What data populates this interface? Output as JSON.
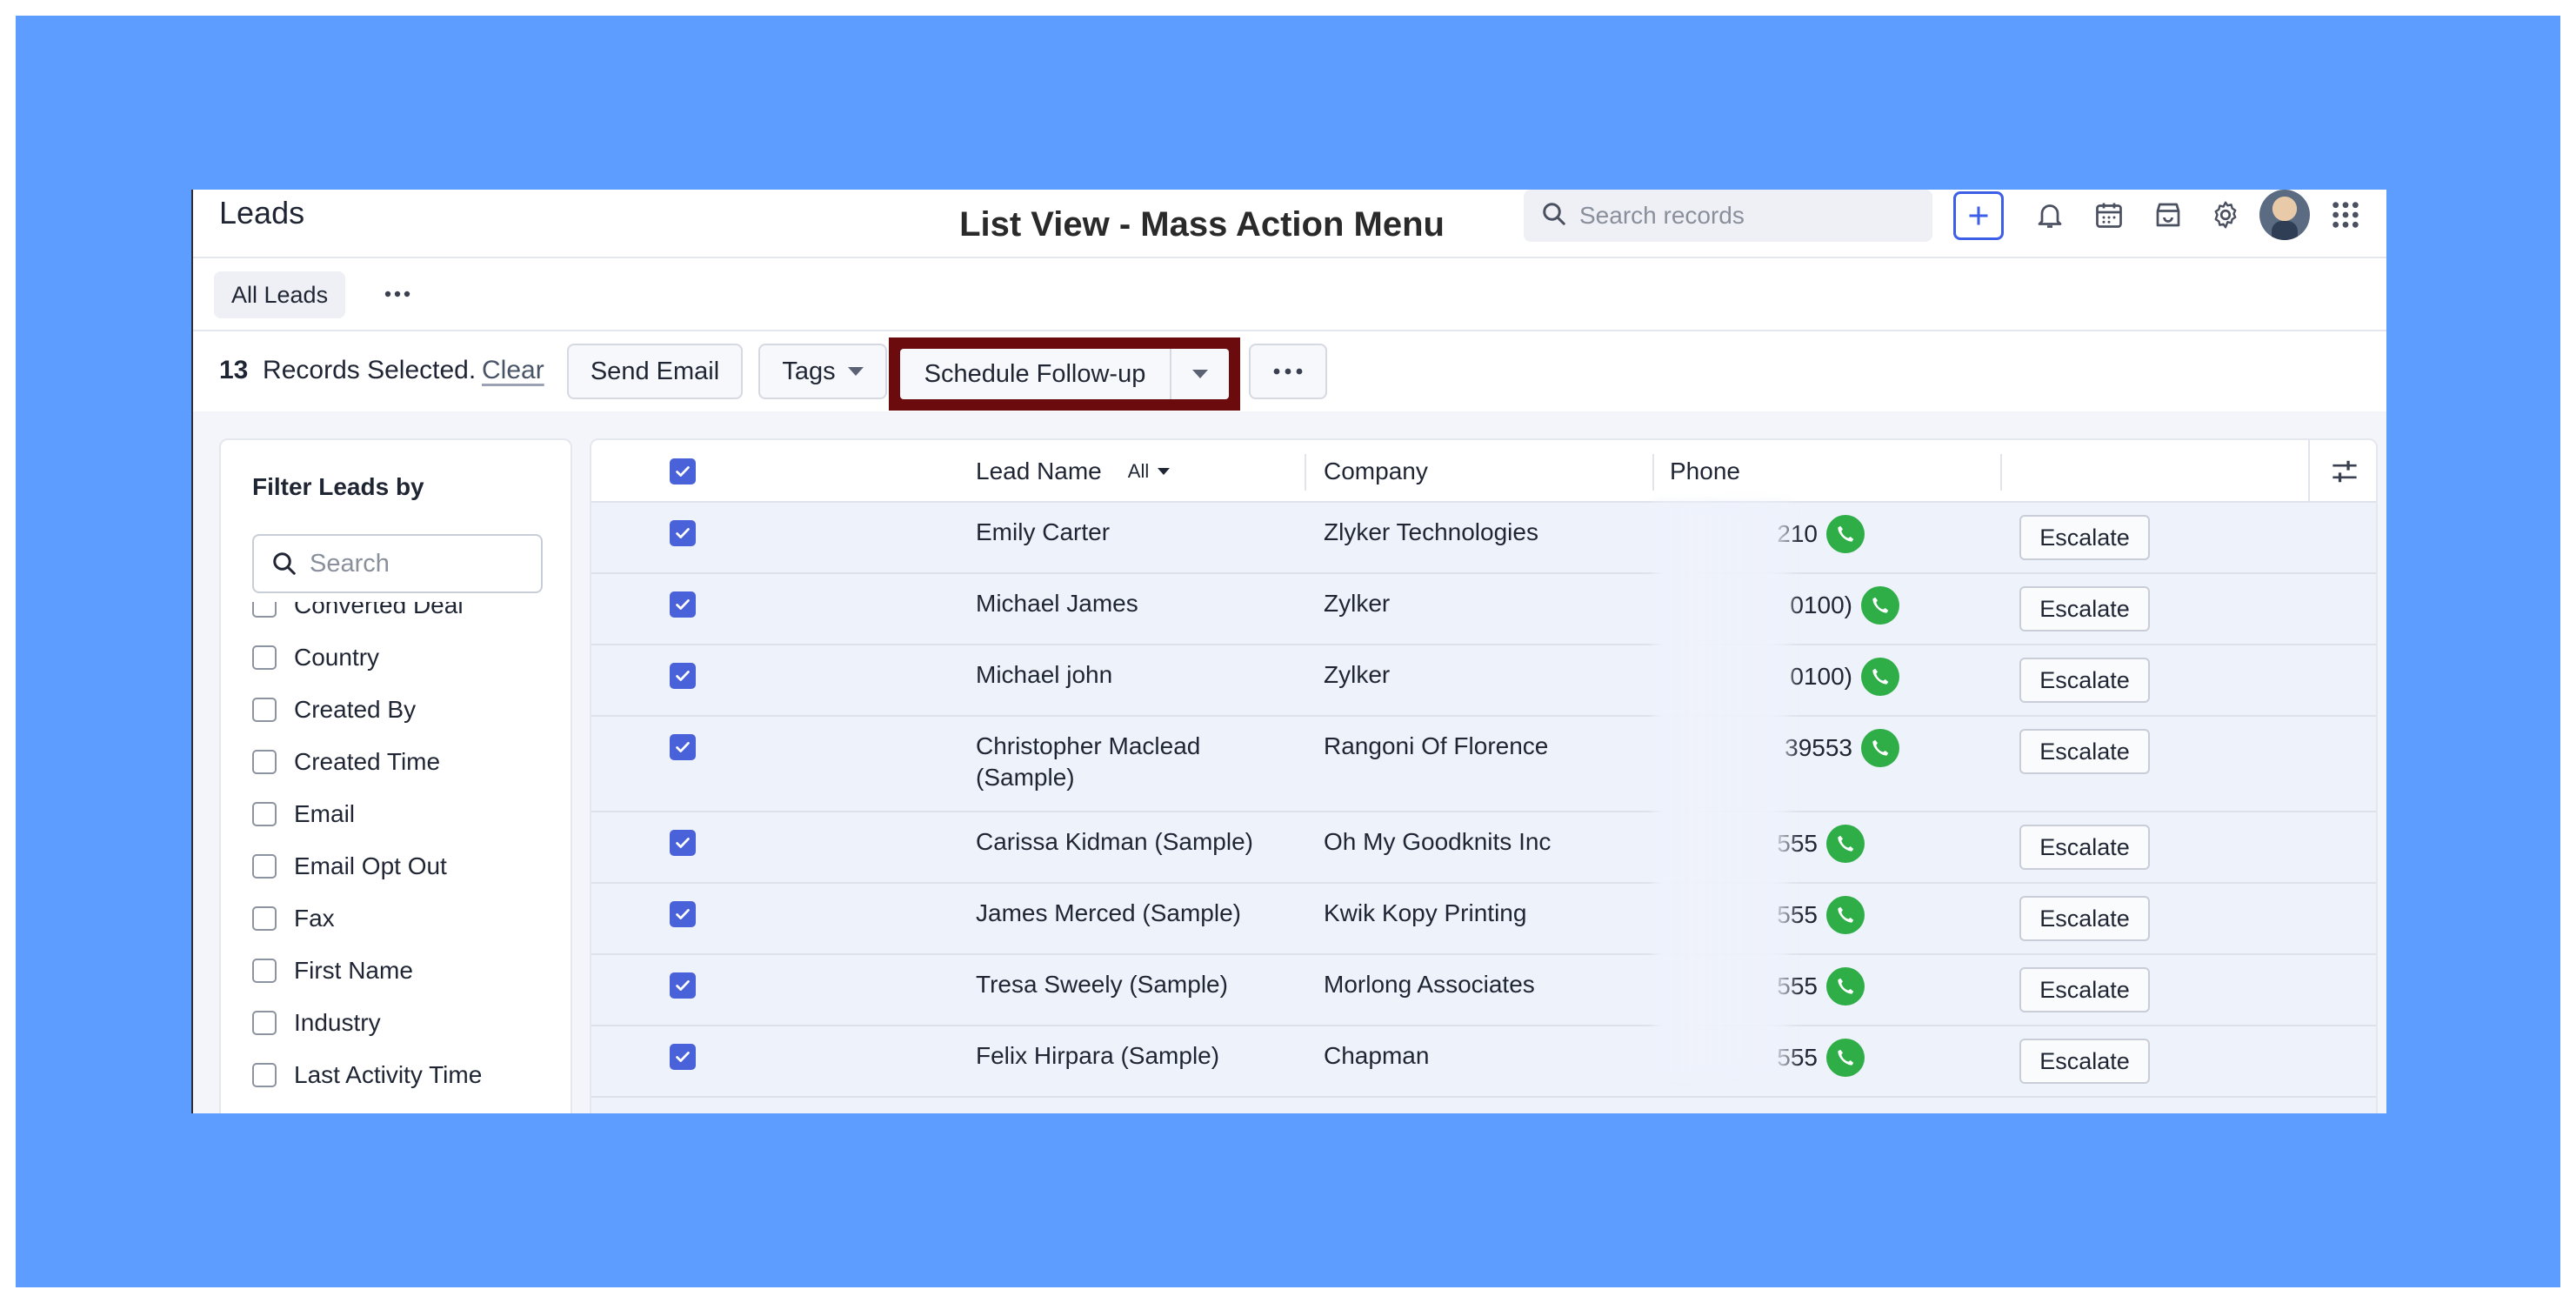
{
  "module_title": "Leads",
  "page_heading": "List View - Mass Action Menu",
  "search": {
    "placeholder": "Search records"
  },
  "view": {
    "tab_label": "All Leads"
  },
  "selection": {
    "count": "13",
    "label": "Records Selected.",
    "clear": "Clear"
  },
  "actions": {
    "send_email": "Send Email",
    "tags": "Tags",
    "schedule_followup": "Schedule Follow-up"
  },
  "filter": {
    "title": "Filter Leads by",
    "search_placeholder": "Search",
    "items": [
      "Converted Deal",
      "Country",
      "Created By",
      "Created Time",
      "Email",
      "Email Opt Out",
      "Fax",
      "First Name",
      "Industry",
      "Last Activity Time"
    ]
  },
  "table": {
    "columns": {
      "lead_name": "Lead Name",
      "all_filter": "All",
      "company": "Company",
      "phone": "Phone"
    },
    "escalate_label": "Escalate",
    "rows": [
      {
        "name": "Emily Carter",
        "company": "Zlyker Technologies",
        "phone_visible": "210"
      },
      {
        "name": "Michael James",
        "company": "Zylker",
        "phone_visible": "0100)"
      },
      {
        "name": "Michael john",
        "company": "Zylker",
        "phone_visible": "0100)"
      },
      {
        "name": "Christopher Maclead (Sample)",
        "company": "Rangoni Of Florence",
        "phone_visible": "39553"
      },
      {
        "name": "Carissa Kidman (Sample)",
        "company": "Oh My Goodknits Inc",
        "phone_visible": "555"
      },
      {
        "name": "James Merced (Sample)",
        "company": "Kwik Kopy Printing",
        "phone_visible": "555"
      },
      {
        "name": "Tresa Sweely (Sample)",
        "company": "Morlong Associates",
        "phone_visible": "555"
      },
      {
        "name": "Felix Hirpara (Sample)",
        "company": "Chapman",
        "phone_visible": "555"
      }
    ]
  },
  "colors": {
    "backdrop": "#5d9dff",
    "highlight": "#6b0b0e",
    "accent": "#4a62d9",
    "call": "#2fae48"
  }
}
